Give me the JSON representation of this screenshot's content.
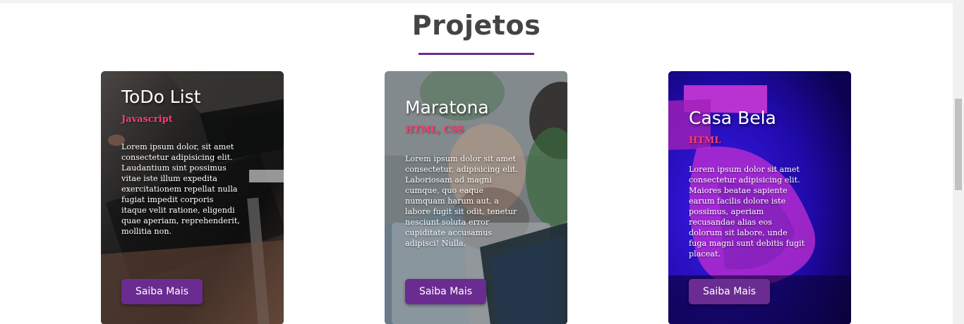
{
  "section": {
    "title": "Projetos"
  },
  "colors": {
    "accent": "#6a2c91",
    "tech_label": "#ff3b72",
    "title_text": "#444444"
  },
  "projects": [
    {
      "title": "ToDo List",
      "tech": "Javascript",
      "description": "Lorem ipsum dolor, sit amet consectetur adipisicing elit. Laudantium sint possimus vitae iste illum expedita exercitationem repellat nulla fugiat impedit corporis itaque velit ratione, eligendi quae aperiam, reprehenderit, mollitia non.",
      "button_label": "Saiba Mais"
    },
    {
      "title": "Maratona",
      "tech": "HTML, CSS",
      "description": "Lorem ipsum dolor sit amet consectetur, adipisicing elit. Laboriosam ad magni cumque, quo eaque numquam harum aut, a labore fugit sit odit, tenetur nesciunt soluta error cupiditate accusamus adipisci! Nulla.",
      "button_label": "Saiba Mais"
    },
    {
      "title": "Casa Bela",
      "tech": "HTML",
      "description": "Lorem ipsum dolor sit amet consectetur adipisicing elit. Maiores beatae sapiente earum facilis dolore iste possimus, aperiam recusandae alias eos dolorum sit labore, unde fuga magni sunt debitis fugit placeat.",
      "button_label": "Saiba Mais"
    }
  ]
}
